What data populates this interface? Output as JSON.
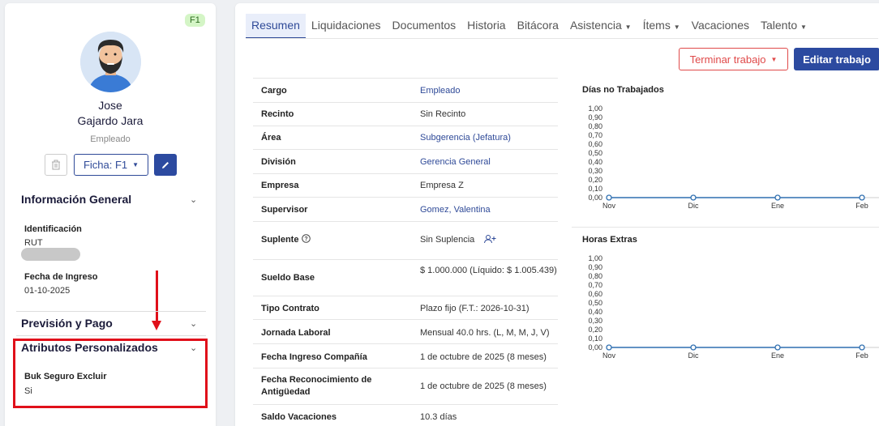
{
  "profile": {
    "badge": "F1",
    "first_name": "Jose",
    "last_name": "Gajardo Jara",
    "role": "Empleado",
    "ficha_label": "Ficha: F1"
  },
  "sections": {
    "general": {
      "title": "Información General",
      "id_label": "Identificación",
      "id_type": "RUT",
      "ingreso_label": "Fecha de Ingreso",
      "ingreso_value": "01-10-2025"
    },
    "prevision": {
      "title": "Previsión y Pago"
    },
    "atributos": {
      "title": "Atributos Personalizados",
      "field_label": "Buk Seguro Excluir",
      "field_value": "Si"
    }
  },
  "tabs": [
    {
      "label": "Resumen"
    },
    {
      "label": "Liquidaciones"
    },
    {
      "label": "Documentos"
    },
    {
      "label": "Historia"
    },
    {
      "label": "Bitácora"
    },
    {
      "label": "Asistencia"
    },
    {
      "label": "Ítems"
    },
    {
      "label": "Vacaciones"
    },
    {
      "label": "Talento"
    }
  ],
  "actions": {
    "terminate": "Terminar trabajo",
    "edit_job": "Editar trabajo"
  },
  "info_rows": [
    {
      "key": "Cargo",
      "value": "Empleado"
    },
    {
      "key": "Recinto",
      "value": "Sin Recinto"
    },
    {
      "key": "Área",
      "value": "Subgerencia (Jefatura)"
    },
    {
      "key": "División",
      "value": "Gerencia General"
    },
    {
      "key": "Empresa",
      "value": "Empresa Z"
    },
    {
      "key": "Supervisor",
      "value": "Gomez, Valentina"
    },
    {
      "key": "Suplente",
      "value": "Sin Suplencia"
    },
    {
      "key": "Sueldo Base",
      "value": "$ 1.000.000 (Líquido: $ 1.005.439)"
    },
    {
      "key": "Tipo Contrato",
      "value": "Plazo fijo (F.T.: 2026-10-31)"
    },
    {
      "key": "Jornada Laboral",
      "value": "Mensual 40.0 hrs. (L, M, M, J, V)"
    },
    {
      "key": "Fecha Ingreso Compañía",
      "value": "1 de octubre de 2025 (8 meses)"
    },
    {
      "key": "Fecha Reconocimiento de Antigüedad",
      "value": "1 de octubre de 2025 (8 meses)"
    },
    {
      "key": "Saldo Vacaciones",
      "value": "10.3 días"
    }
  ],
  "colors": {
    "accent": "#2c4aa0",
    "danger": "#e04a4a",
    "highlight": "#e0101a"
  },
  "chart_data": [
    {
      "type": "line",
      "title": "Días no Trabajados",
      "categories": [
        "Nov",
        "Dic",
        "Ene",
        "Feb"
      ],
      "series": [
        {
          "values": [
            0,
            0,
            0,
            0
          ]
        }
      ],
      "ylim": [
        0,
        1
      ],
      "yticks": [
        "1,00",
        "0,90",
        "0,80",
        "0,70",
        "0,60",
        "0,50",
        "0,40",
        "0,30",
        "0,20",
        "0,10",
        "0,00"
      ]
    },
    {
      "type": "line",
      "title": "Horas Extras",
      "categories": [
        "Nov",
        "Dic",
        "Ene",
        "Feb"
      ],
      "series": [
        {
          "values": [
            0,
            0,
            0,
            0
          ]
        }
      ],
      "ylim": [
        0,
        1
      ],
      "yticks": [
        "1,00",
        "0,90",
        "0,80",
        "0,70",
        "0,60",
        "0,50",
        "0,40",
        "0,30",
        "0,20",
        "0,10",
        "0,00"
      ]
    }
  ]
}
